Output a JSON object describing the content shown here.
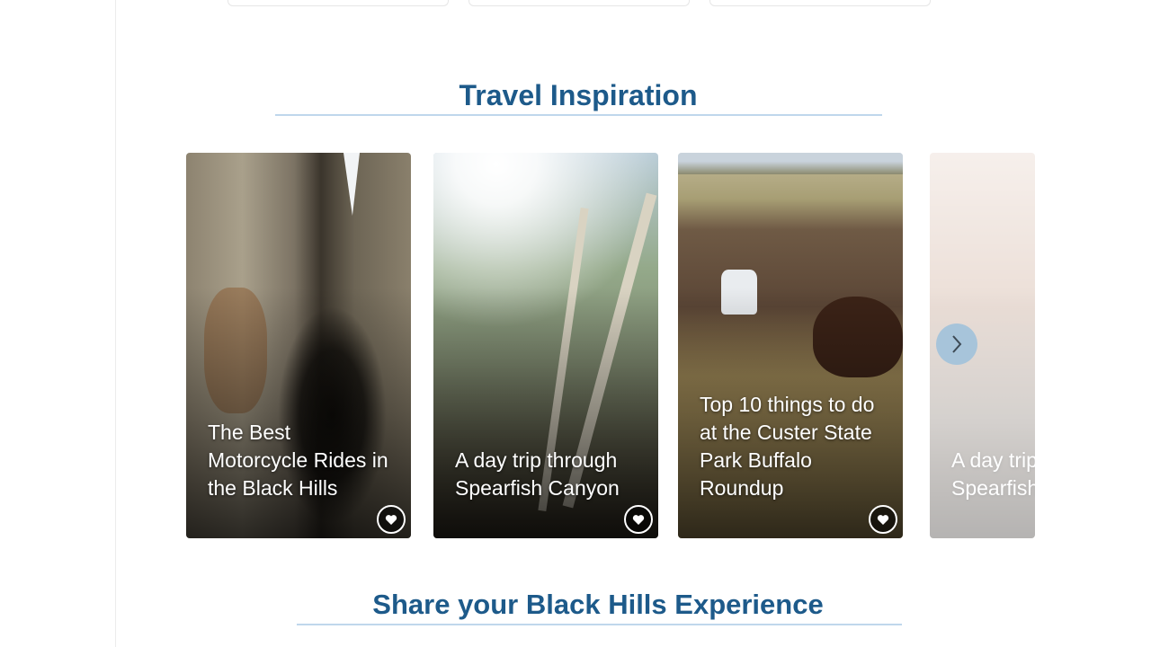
{
  "sections": {
    "travel_title": "Travel Inspiration",
    "share_title": "Share your Black Hills Experience"
  },
  "cards": [
    {
      "title": "The Best Motorcycle Rides in the Black Hills",
      "icon": "heart-icon"
    },
    {
      "title": "A day trip through Spearfish Canyon",
      "icon": "heart-icon"
    },
    {
      "title": "Top 10 things to do at the Custer State Park Buffalo Roundup",
      "icon": "heart-icon"
    },
    {
      "title": "A day trip through Spearfish Canyon",
      "icon": "heart-icon"
    }
  ],
  "carousel": {
    "next_icon": "chevron-right-icon"
  },
  "colors": {
    "heading": "#1d5a8a",
    "underline": "#bfd7ec",
    "nav_button": "#a7c4da"
  }
}
